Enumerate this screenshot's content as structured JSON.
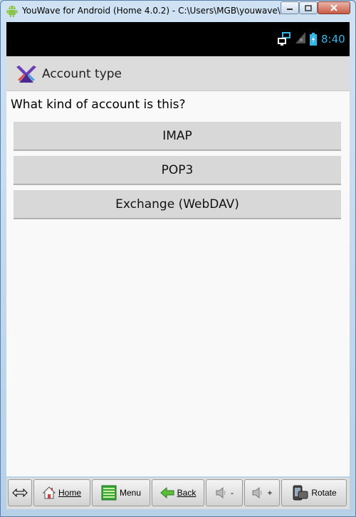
{
  "window": {
    "title": "YouWave for Android (Home 4.0.2) - C:\\Users\\MGB\\youwave\\"
  },
  "statusbar": {
    "time": "8:40"
  },
  "actionbar": {
    "title": "Account type"
  },
  "content": {
    "question": "What kind of account is this?",
    "options": [
      {
        "label": "IMAP"
      },
      {
        "label": "POP3"
      },
      {
        "label": "Exchange (WebDAV)"
      }
    ]
  },
  "toolbar": {
    "home_label": "Home",
    "menu_label": "Menu",
    "back_label": "Back",
    "vol_down_label": "-",
    "vol_up_label": "+",
    "rotate_label": "Rotate"
  },
  "colors": {
    "time_accent": "#33b5e5",
    "actionbar_bg": "#dcdcdc",
    "button_bg": "#d8d8d8"
  }
}
